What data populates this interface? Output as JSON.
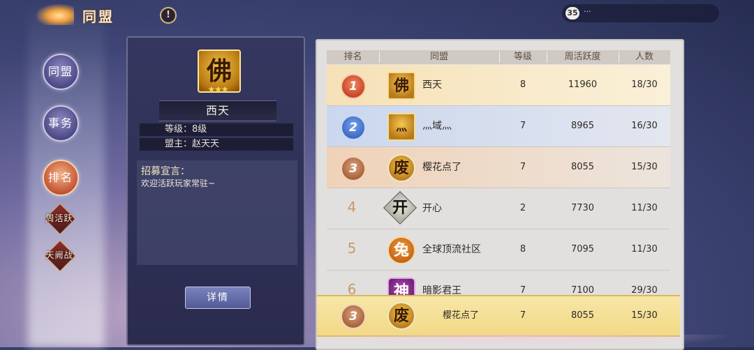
{
  "header": {
    "title": "同盟",
    "info_icon": "!",
    "chat_badge": "35",
    "chat_text": "...",
    "info_icon_name": "exclamation-icon"
  },
  "nav": {
    "items": [
      {
        "label": "同盟",
        "active": false
      },
      {
        "label": "事务",
        "active": false
      },
      {
        "label": "排名",
        "active": true
      }
    ],
    "sub_items": [
      {
        "label": "周活跃"
      },
      {
        "label": "天阙战"
      }
    ]
  },
  "guild_card": {
    "emblem_char": "佛",
    "stars": "★★★",
    "name": "西天",
    "level_label": "等级：8级",
    "leader_label": "盟主：赵天天",
    "recruit_title": "招募宣言：",
    "recruit_text": "欢迎活跃玩家常驻~",
    "detail_button": "详情"
  },
  "ranking": {
    "headers": [
      "排名",
      "同盟",
      "等级",
      "周活跃度",
      "人数"
    ],
    "rows": [
      {
        "rank": "1",
        "emblem": "佛",
        "name": "西天",
        "level": "8",
        "activity": "11960",
        "members": "18/30"
      },
      {
        "rank": "2",
        "emblem": "灬",
        "name": "灬域灬",
        "level": "7",
        "activity": "8965",
        "members": "16/30"
      },
      {
        "rank": "3",
        "emblem": "废",
        "name": "樱花点了",
        "level": "7",
        "activity": "8055",
        "members": "15/30"
      },
      {
        "rank": "4",
        "emblem": "开",
        "name": "开心",
        "level": "2",
        "activity": "7730",
        "members": "11/30"
      },
      {
        "rank": "5",
        "emblem": "兔",
        "name": "全球顶流社区",
        "level": "8",
        "activity": "7095",
        "members": "11/30"
      },
      {
        "rank": "6",
        "emblem": "神",
        "name": "暗影君王",
        "level": "7",
        "activity": "7100",
        "members": "29/30"
      }
    ],
    "my_row": {
      "rank": "3",
      "emblem": "废",
      "name": "樱花点了",
      "level": "7",
      "activity": "8055",
      "members": "15/30"
    }
  },
  "colors": {
    "gold_medal": "#d9653a",
    "silver_medal": "#4d7fd6",
    "bronze_medal": "#b9764f",
    "row1_bg": "#f7e7c0",
    "row2_bg": "#d2def1",
    "row3_bg": "#f3dcc7"
  }
}
